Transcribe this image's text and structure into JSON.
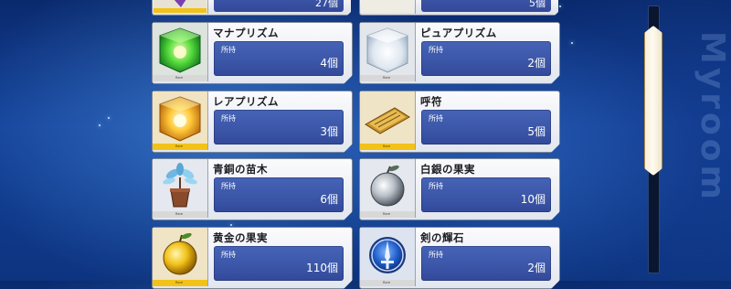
{
  "watermark": "Myroom",
  "owned_label": "所持",
  "rare_label": "Rare",
  "top_row": [
    {
      "count": "27個"
    },
    {
      "count": "5個"
    }
  ],
  "items": [
    {
      "name": "マナプリズム",
      "count": "4個",
      "icon": "green-cube-icon"
    },
    {
      "name": "ピュアプリズム",
      "count": "2個",
      "icon": "white-cube-icon"
    },
    {
      "name": "レアプリズム",
      "count": "3個",
      "icon": "gold-cube-icon"
    },
    {
      "name": "呼符",
      "count": "5個",
      "icon": "summon-ticket-icon"
    },
    {
      "name": "青銅の苗木",
      "count": "6個",
      "icon": "bronze-sapling-icon"
    },
    {
      "name": "白銀の果実",
      "count": "10個",
      "icon": "silver-fruit-icon"
    },
    {
      "name": "黄金の果実",
      "count": "110個",
      "icon": "golden-fruit-icon"
    },
    {
      "name": "剣の輝石",
      "count": "2個",
      "icon": "saber-gem-icon"
    }
  ]
}
